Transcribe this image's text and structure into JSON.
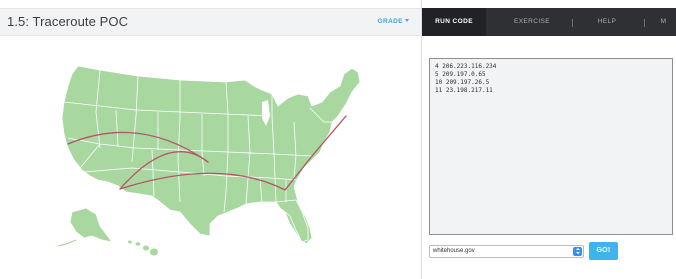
{
  "lesson": {
    "title": "1.5: Traceroute POC",
    "grade_label": "GRADE"
  },
  "tabs": [
    {
      "label": "RUN CODE",
      "active": true
    },
    {
      "label": "EXERCISE",
      "active": false
    },
    {
      "label": "HELP",
      "active": false
    },
    {
      "label": "M",
      "active": false
    }
  ],
  "output": {
    "lines": [
      "4 206.223.116.234",
      "5 209.197.0.65",
      "10 209.197.26.5",
      "11 23.198.217.11"
    ]
  },
  "host_select": {
    "value": "whitehouse.gov"
  },
  "go_label": "GO!",
  "colors": {
    "map_fill": "#a8d8a0",
    "state_border": "#ffffff",
    "route_line": "#b2566a",
    "accent": "#41b3ec",
    "tab_bar": "#2e3034"
  },
  "icons": {
    "grade": "caret-down-icon",
    "select": "select-arrows-icon"
  }
}
